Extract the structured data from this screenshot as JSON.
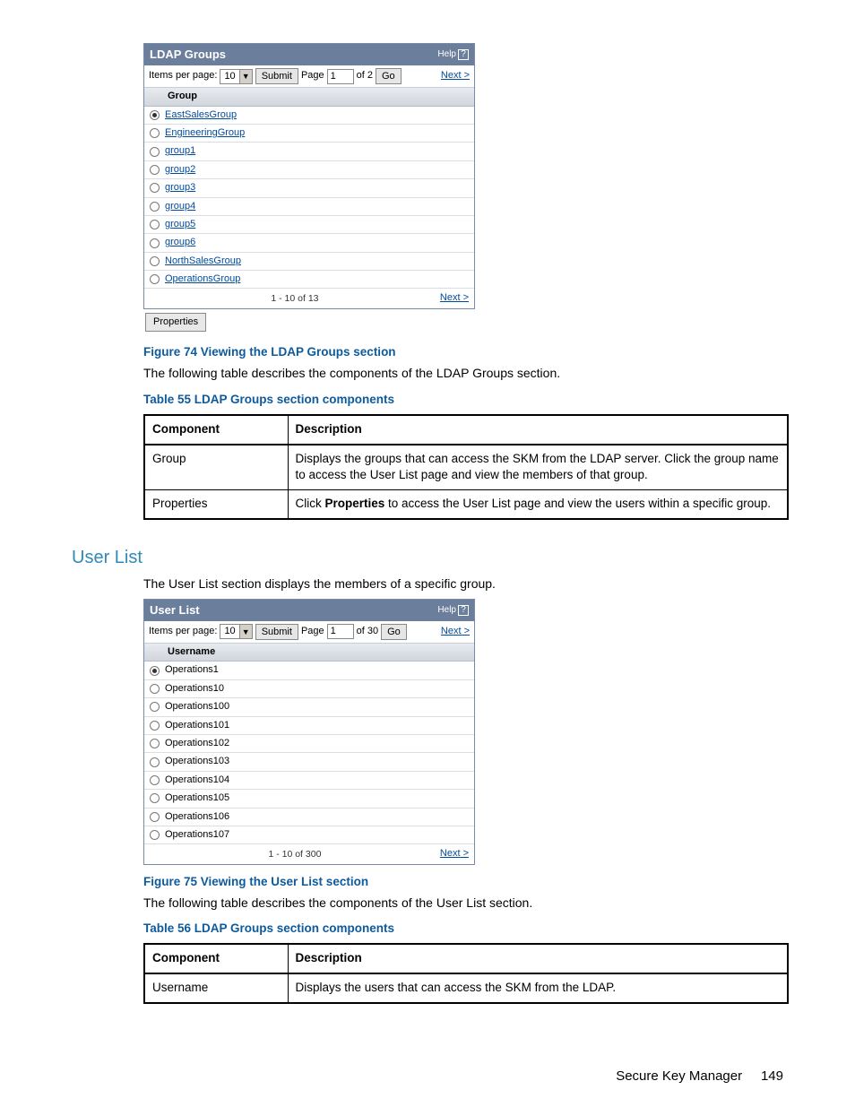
{
  "ldap_panel": {
    "title": "LDAP Groups",
    "help": "Help",
    "items_per_page_label": "Items per page:",
    "items_per_page_value": "10",
    "submit": "Submit",
    "page_label": "Page",
    "page_value": "1",
    "of_label": "of 2",
    "go": "Go",
    "next": "Next >",
    "header": "Group",
    "rows": [
      {
        "name": "EastSalesGroup",
        "selected": true
      },
      {
        "name": "EngineeringGroup",
        "selected": false
      },
      {
        "name": "group1",
        "selected": false
      },
      {
        "name": "group2",
        "selected": false
      },
      {
        "name": "group3",
        "selected": false
      },
      {
        "name": "group4",
        "selected": false
      },
      {
        "name": "group5",
        "selected": false
      },
      {
        "name": "group6",
        "selected": false
      },
      {
        "name": "NorthSalesGroup",
        "selected": false
      },
      {
        "name": "OperationsGroup",
        "selected": false
      }
    ],
    "range": "1 - 10 of 13",
    "properties_btn": "Properties"
  },
  "fig74": "Figure 74 Viewing the LDAP Groups section",
  "para1": "The following table describes the components of the LDAP Groups section.",
  "tbl55_cap": "Table 55 LDAP Groups section components",
  "tbl_headers": {
    "c": "Component",
    "d": "Description"
  },
  "tbl55": [
    {
      "c": "Group",
      "d": "Displays the groups that can access the SKM from the LDAP server. Click the group name to access the User List page and view the members of that group."
    },
    {
      "c": "Properties",
      "d_pre": "Click ",
      "d_bold": "Properties",
      "d_post": " to access the User List page and view the users within a specific group."
    }
  ],
  "userlist_heading": "User List",
  "para2": "The User List section displays the members of a specific group.",
  "user_panel": {
    "title": "User List",
    "help": "Help",
    "items_per_page_label": "Items per page:",
    "items_per_page_value": "10",
    "submit": "Submit",
    "page_label": "Page",
    "page_value": "1",
    "of_label": "of 30",
    "go": "Go",
    "next": "Next >",
    "header": "Username",
    "rows": [
      {
        "name": "Operations1",
        "selected": true
      },
      {
        "name": "Operations10",
        "selected": false
      },
      {
        "name": "Operations100",
        "selected": false
      },
      {
        "name": "Operations101",
        "selected": false
      },
      {
        "name": "Operations102",
        "selected": false
      },
      {
        "name": "Operations103",
        "selected": false
      },
      {
        "name": "Operations104",
        "selected": false
      },
      {
        "name": "Operations105",
        "selected": false
      },
      {
        "name": "Operations106",
        "selected": false
      },
      {
        "name": "Operations107",
        "selected": false
      }
    ],
    "range": "1 - 10 of 300"
  },
  "fig75": "Figure 75 Viewing the User List section",
  "para3": "The following table describes the components of the User List section.",
  "tbl56_cap": "Table 56 LDAP Groups section components",
  "tbl56": [
    {
      "c": "Username",
      "d": "Displays the users that can access the SKM from the LDAP."
    }
  ],
  "footer": {
    "doc": "Secure Key Manager",
    "page": "149"
  }
}
